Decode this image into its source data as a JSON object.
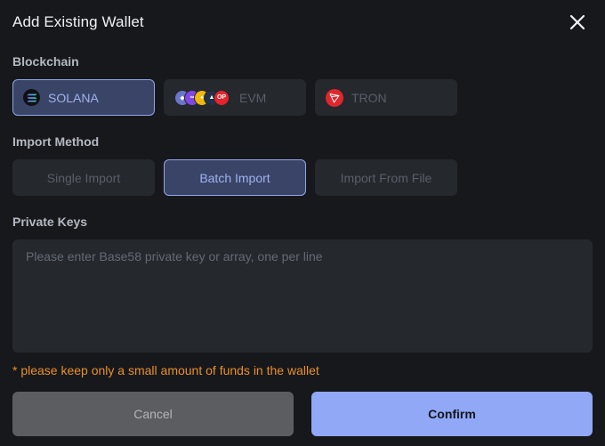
{
  "dialog": {
    "title": "Add Existing Wallet",
    "close_icon": "close-icon"
  },
  "blockchain": {
    "label": "Blockchain",
    "options": [
      {
        "label": "SOLANA",
        "icon": "solana-icon",
        "selected": true
      },
      {
        "label": "EVM",
        "icon": "evm-chains-icon",
        "selected": false
      },
      {
        "label": "TRON",
        "icon": "tron-icon",
        "selected": false
      }
    ]
  },
  "import_method": {
    "label": "Import Method",
    "options": [
      {
        "label": "Single Import",
        "selected": false
      },
      {
        "label": "Batch Import",
        "selected": true
      },
      {
        "label": "Import From File",
        "selected": false
      }
    ]
  },
  "private_keys": {
    "label": "Private Keys",
    "value": "",
    "placeholder": "Please enter Base58 private key or array, one per line"
  },
  "warning": "* please keep only a small amount of funds in the wallet",
  "actions": {
    "cancel_label": "Cancel",
    "confirm_label": "Confirm"
  },
  "colors": {
    "background": "#17181c",
    "accent": "#90a8f6",
    "warning": "#e8902c"
  }
}
